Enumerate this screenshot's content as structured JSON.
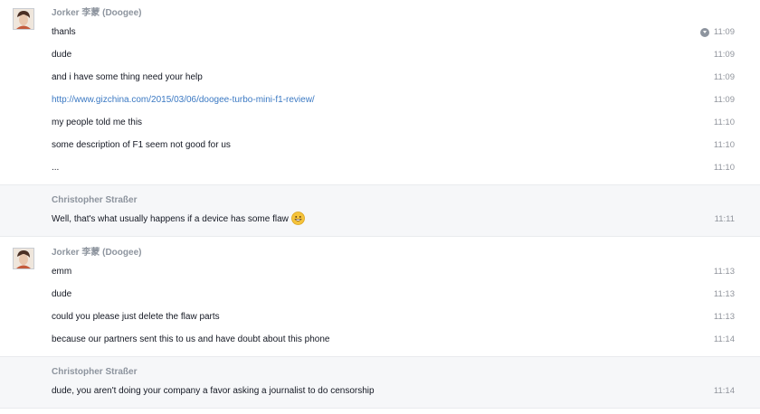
{
  "groups": [
    {
      "sender": "Jorker 李蒙 (Doogee)",
      "messages": [
        {
          "text": "thanls",
          "time": "11:09"
        },
        {
          "text": "dude",
          "time": "11:09"
        },
        {
          "text": "and i have some thing need your help",
          "time": "11:09"
        },
        {
          "text": "http://www.gizchina.com/2015/03/06/doogee-turbo-mini-f1-review/",
          "time": "11:09"
        },
        {
          "text": "my people told me this",
          "time": "11:10"
        },
        {
          "text": "some description of F1 seem not good for us",
          "time": "11:10"
        },
        {
          "text": "...",
          "time": "11:10"
        }
      ]
    },
    {
      "sender": "Christopher Straßer",
      "messages": [
        {
          "text": "Well, that's what usually happens if a device has some flaw",
          "time": "11:11"
        }
      ]
    },
    {
      "sender": "Jorker 李蒙 (Doogee)",
      "messages": [
        {
          "text": "emm",
          "time": "11:13"
        },
        {
          "text": "dude",
          "time": "11:13"
        },
        {
          "text": "could you please just delete the flaw parts",
          "time": "11:13"
        },
        {
          "text": "because our partners sent this to us and have doubt about this phone",
          "time": "11:14"
        }
      ]
    },
    {
      "sender": "Christopher Straßer",
      "messages": [
        {
          "text": "dude, you aren't doing your company a favor asking a journalist to do censorship",
          "time": "11:14"
        }
      ]
    }
  ],
  "icons": {
    "avatar": "profile-photo",
    "read_receipt": "seen-indicator-icon",
    "emoji": "grinning-face-emoji"
  },
  "colors": {
    "link": "#3b79c3",
    "sender": "#8d949e",
    "timestamp": "#90949c",
    "shaded_row": "#f6f7f9"
  }
}
